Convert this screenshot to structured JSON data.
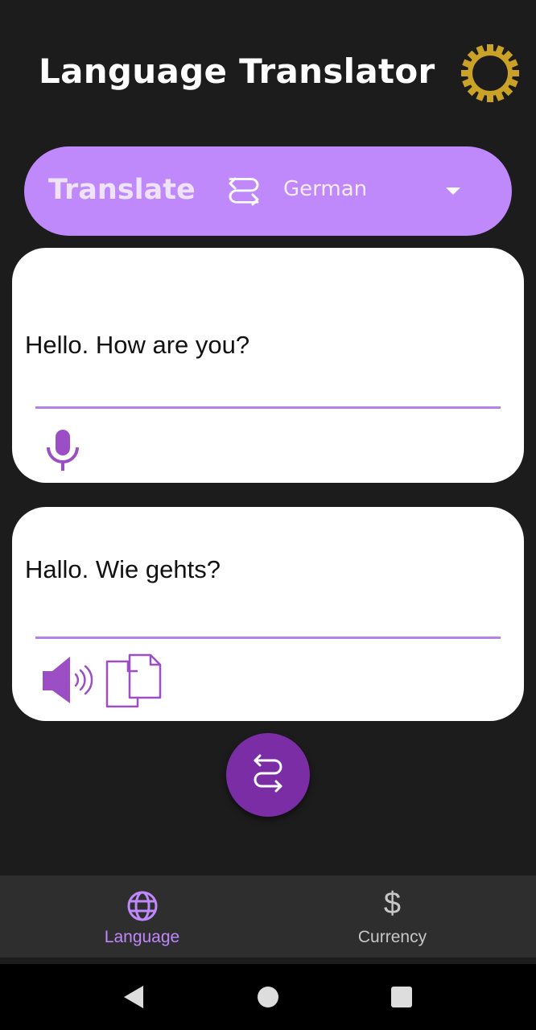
{
  "header": {
    "title": "Language Translator",
    "settings_icon": "gear-icon"
  },
  "language_bar": {
    "translate_label": "Translate",
    "swap_icon": "swap-arrows-icon",
    "selected_language": "German",
    "dropdown_icon": "caret-down-icon"
  },
  "input_card": {
    "text": "Hello. How are you?",
    "mic_icon": "microphone-icon"
  },
  "output_card": {
    "text": "Hallo. Wie gehts?",
    "speaker_icon": "speaker-icon",
    "copy_icon": "copy-icon"
  },
  "fab": {
    "icon": "swap-arrows-icon"
  },
  "bottom_nav": {
    "items": [
      {
        "label": "Language",
        "icon": "globe-icon",
        "active": true
      },
      {
        "label": "Currency",
        "icon": "dollar-icon",
        "active": false
      }
    ]
  },
  "colors": {
    "accent": "#bf88fb",
    "primary_dark": "#7b2da6",
    "icon_purple": "#9c4fc4",
    "background": "#1c1c1c",
    "gear_gold": "#c9a227"
  }
}
